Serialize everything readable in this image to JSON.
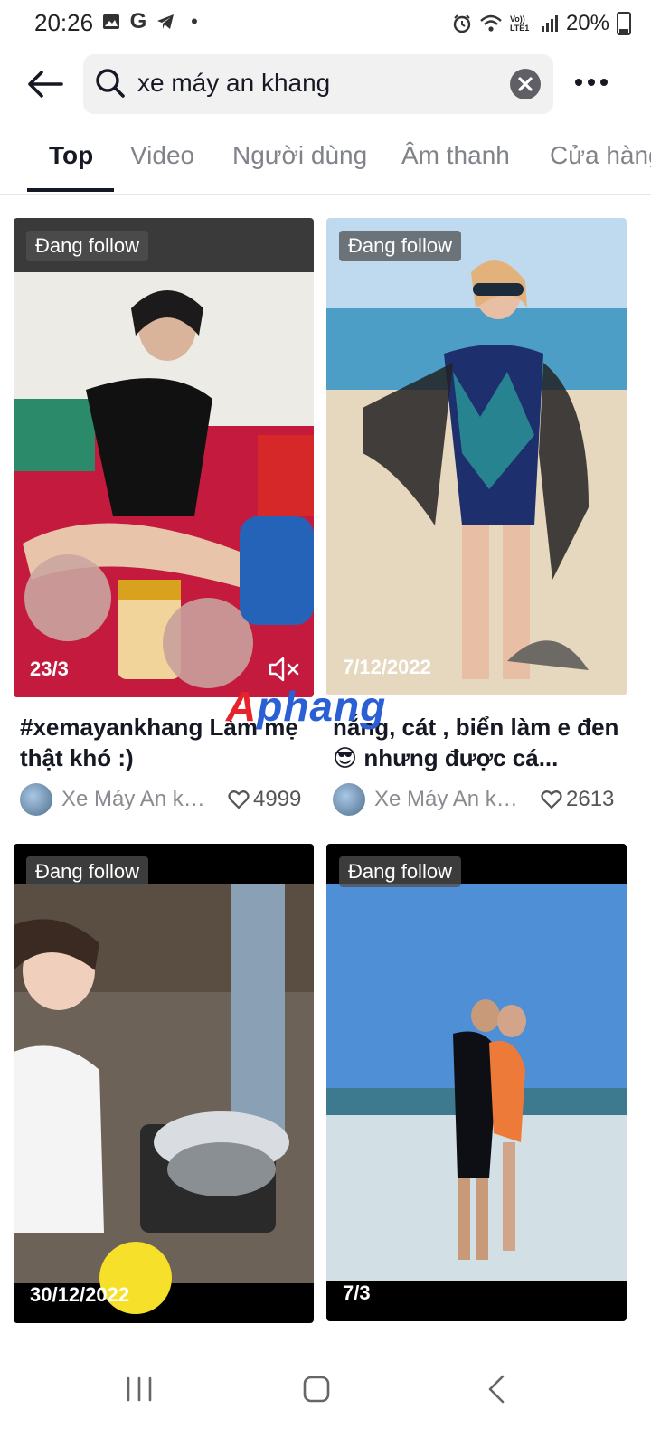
{
  "status_bar": {
    "time": "20:26",
    "left_icons": [
      "gallery-icon",
      "google-icon",
      "telegram-icon",
      "dot-icon"
    ],
    "right_icons": [
      "alarm-icon",
      "wifi-icon",
      "volte-icon",
      "signal-icon"
    ],
    "volte_label": "Vo)) LTE1",
    "battery": "20%"
  },
  "header": {
    "search_query": "xe máy an khang"
  },
  "tabs": [
    "Top",
    "Video",
    "Người dùng",
    "Âm thanh",
    "Cửa hàng"
  ],
  "active_tab": "Top",
  "watermark": {
    "part1": "A",
    "part2": "phang"
  },
  "results": [
    {
      "badge": "Đang follow",
      "date": "23/3",
      "caption": "#xemayankhang Làm mẹ thật khó :)",
      "author": "Xe Máy An khang",
      "likes": "4999"
    },
    {
      "badge": "Đang follow",
      "date": "7/12/2022",
      "caption": "nắng, cát , biển làm e đen 😎 nhưng được cá...",
      "author": "Xe Máy An khang",
      "likes": "2613"
    },
    {
      "badge": "Đang follow",
      "date": "30/12/2022"
    },
    {
      "badge": "Đang follow",
      "date": "7/3"
    }
  ],
  "colors": {
    "accent_text": "#161823",
    "muted": "#80838a",
    "watermark_red": "#e8222a",
    "watermark_blue": "#2a5fd6"
  }
}
